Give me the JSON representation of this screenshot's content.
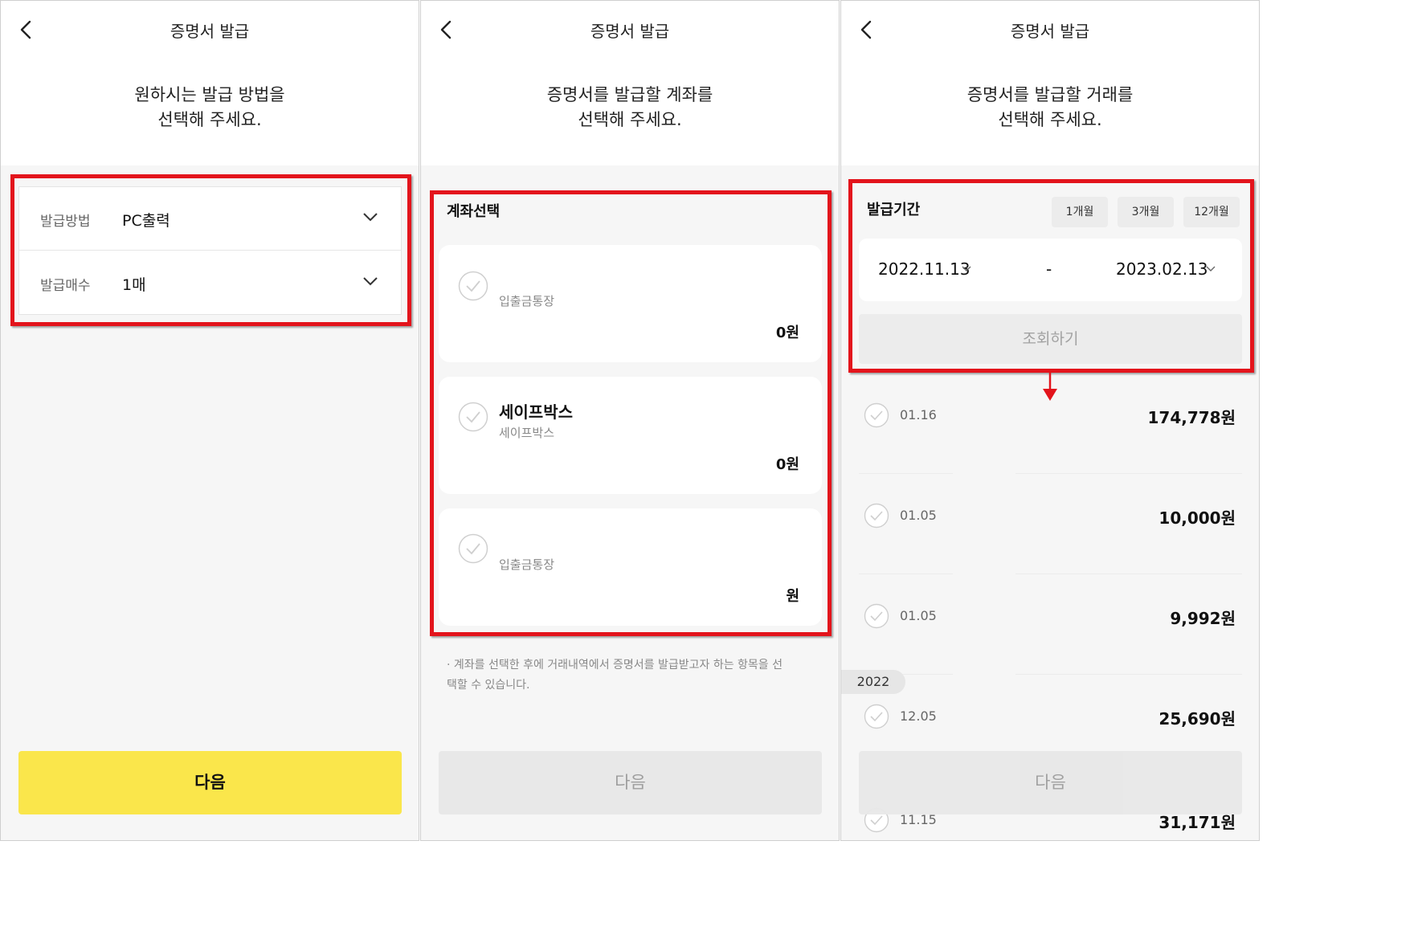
{
  "header_title": "증명서 발급",
  "panel1": {
    "instruction_line1": "원하시는 발급 방법을",
    "instruction_line2": "선택해 주세요.",
    "method_label": "발급방법",
    "method_value": "PC출력",
    "copies_label": "발급매수",
    "copies_value": "1매",
    "next_label": "다음"
  },
  "panel2": {
    "instruction_line1": "증명서를 발급할 계좌를",
    "instruction_line2": "선택해 주세요.",
    "section_title": "계좌선택",
    "accounts": [
      {
        "name": "",
        "subtitle": "입출금통장",
        "amount": "0원"
      },
      {
        "name": "세이프박스",
        "subtitle": "세이프박스",
        "amount": "0원"
      },
      {
        "name": "",
        "subtitle": "입출금통장",
        "amount": "원"
      }
    ],
    "note_line1": "· 계좌를 선택한 후에 거래내역에서 증명서를 발급받고자 하는 항목을 선",
    "note_line2": "택할 수 있습니다.",
    "next_label": "다음"
  },
  "panel3": {
    "instruction_line1": "증명서를 발급할 거래를",
    "instruction_line2": "선택해 주세요.",
    "period_title": "발급기간",
    "period_buttons": [
      "1개월",
      "3개월",
      "12개월"
    ],
    "start_date": "2022.11.13",
    "date_separator": "-",
    "end_date": "2023.02.13",
    "query_label": "조회하기",
    "transactions": [
      {
        "date": "01.16",
        "amount": "174,778원"
      },
      {
        "date": "01.05",
        "amount": "10,000원"
      },
      {
        "date": "01.05",
        "amount": "9,992원"
      },
      {
        "date": "12.05",
        "amount": "25,690원"
      }
    ],
    "year_tag": "2022",
    "partial_transaction": {
      "date": "11.15",
      "amount": "31,171원"
    },
    "next_label": "다음"
  },
  "colors": {
    "highlight": "#e3141c",
    "primary_button": "#fae64b",
    "disabled_button": "#e8e8e8"
  },
  "icons": [
    "back-arrow-icon",
    "chevron-down-icon",
    "check-circle-icon",
    "down-arrow-icon"
  ]
}
